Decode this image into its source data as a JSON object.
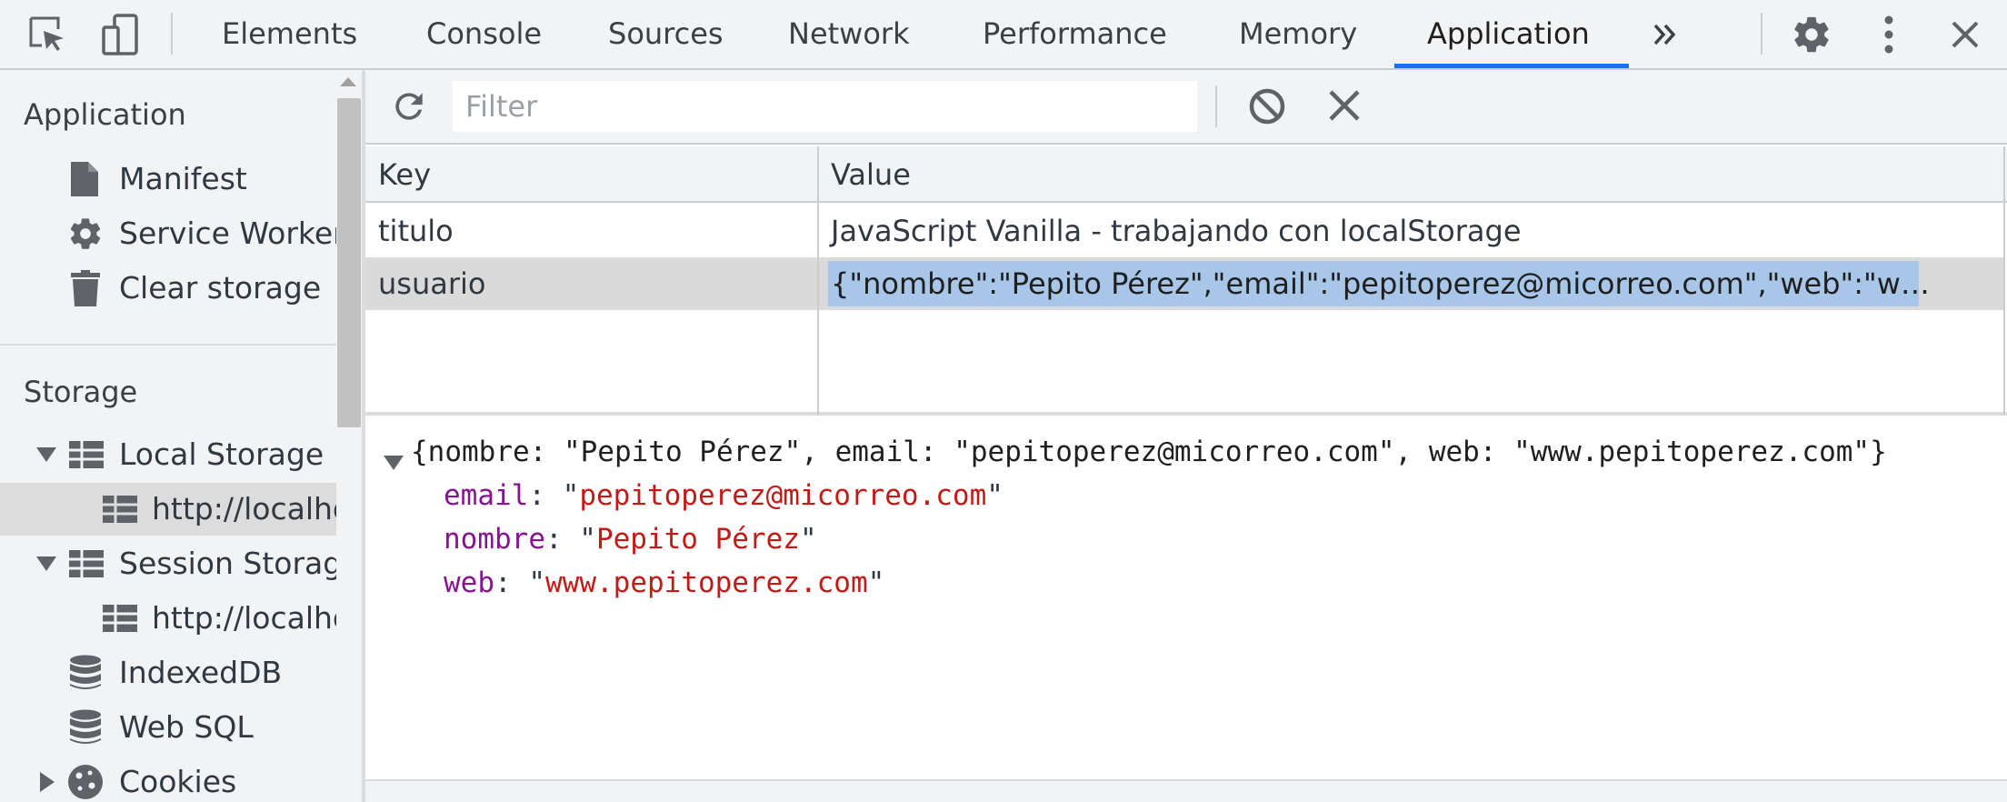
{
  "toolbar": {
    "tabs": [
      {
        "label": "Elements"
      },
      {
        "label": "Console"
      },
      {
        "label": "Sources"
      },
      {
        "label": "Network"
      },
      {
        "label": "Performance"
      },
      {
        "label": "Memory"
      },
      {
        "label": "Application"
      }
    ],
    "active_tab": "Application",
    "more_tabs_icon": "double-chevron-right-icon",
    "icons": [
      "inspect-element-icon",
      "device-toolbar-icon",
      "gear-icon",
      "kebab-menu-icon",
      "close-icon"
    ],
    "accent_color": "#1a73e8"
  },
  "sidebar": {
    "application_header": "Application",
    "application_items": [
      {
        "label": "Manifest",
        "icon": "document-icon"
      },
      {
        "label": "Service Workers",
        "icon": "gear-icon"
      },
      {
        "label": "Clear storage",
        "icon": "trash-icon"
      }
    ],
    "storage_header": "Storage",
    "storage_items": [
      {
        "label": "Local Storage",
        "icon": "table-icon",
        "expanded": true
      },
      {
        "label": "http://localhost",
        "icon": "table-icon",
        "selected": true
      },
      {
        "label": "Session Storage",
        "icon": "table-icon",
        "expanded": true
      },
      {
        "label": "http://localhost",
        "icon": "table-icon"
      },
      {
        "label": "IndexedDB",
        "icon": "database-icon"
      },
      {
        "label": "Web SQL",
        "icon": "database-icon"
      },
      {
        "label": "Cookies",
        "icon": "cookie-icon",
        "expanded": false
      }
    ]
  },
  "storage_toolbar": {
    "filter_placeholder": "Filter",
    "icons": [
      "refresh-icon",
      "clear-all-icon",
      "delete-selected-icon"
    ]
  },
  "grid": {
    "columns": [
      "Key",
      "Value"
    ],
    "rows": [
      {
        "key": "titulo",
        "value": "JavaScript Vanilla - trabajando con localStorage"
      },
      {
        "key": "usuario",
        "value": "{\"nombre\":\"Pepito Pérez\",\"email\":\"pepitoperez@micorreo.com\",\"web\":\"www.pepitoperez.com\"}",
        "selected": true
      }
    ]
  },
  "preview": {
    "summary": "{nombre: \"Pepito Pérez\", email: \"pepitoperez@micorreo.com\", web: \"www.pepitoperez.com\"}",
    "properties": [
      {
        "key": "email",
        "value": "pepitoperez@micorreo.com"
      },
      {
        "key": "nombre",
        "value": "Pepito Pérez"
      },
      {
        "key": "web",
        "value": "www.pepitoperez.com"
      }
    ]
  }
}
